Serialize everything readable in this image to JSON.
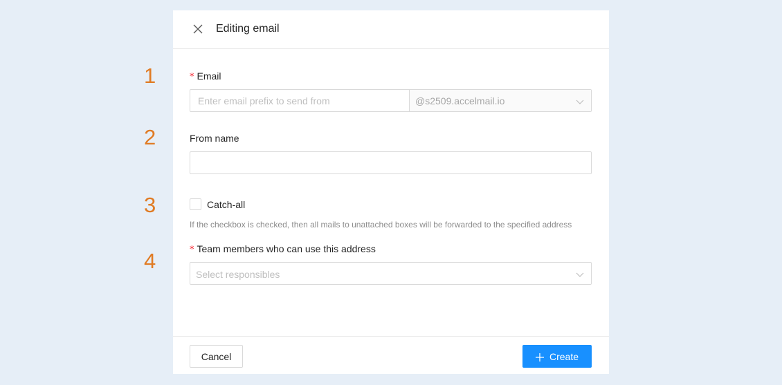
{
  "steps": [
    "1",
    "2",
    "3",
    "4"
  ],
  "modal": {
    "title": "Editing email",
    "close_icon": "close-icon"
  },
  "form": {
    "email": {
      "label": "Email",
      "required_mark": "*",
      "placeholder": "Enter email prefix to send from",
      "value": "",
      "domain": "@s2509.accelmail.io"
    },
    "from_name": {
      "label": "From name",
      "value": ""
    },
    "catch_all": {
      "label": "Catch-all",
      "checked": false,
      "hint": "If the checkbox is checked, then all mails to unattached boxes will be forwarded to the specified address"
    },
    "team_members": {
      "label": "Team members who can use this address",
      "required_mark": "*",
      "placeholder": "Select responsibles"
    }
  },
  "footer": {
    "cancel_label": "Cancel",
    "create_label": "Create",
    "create_icon": "plus-icon"
  },
  "colors": {
    "page_bg": "#e6eef7",
    "step_number": "#e07b24",
    "primary": "#1890ff",
    "required": "#f5222d"
  }
}
